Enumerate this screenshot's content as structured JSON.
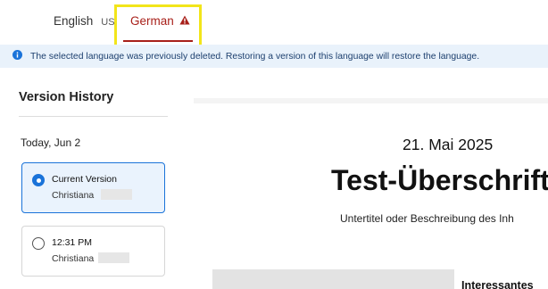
{
  "tabs": {
    "english": {
      "label": "English",
      "region": "US"
    },
    "german": {
      "label": "German"
    }
  },
  "banner": {
    "message": "The selected language was previously deleted. Restoring a version of this language will restore the language."
  },
  "sidebar": {
    "title": "Version History",
    "date_header": "Today, Jun 2",
    "versions": [
      {
        "title": "Current Version",
        "author": "Christiana",
        "selected": true
      },
      {
        "title": "12:31 PM",
        "author": "Christiana",
        "selected": false
      }
    ]
  },
  "preview": {
    "date": "21. Mai 2025",
    "heading": "Test-Überschrift",
    "subtitle": "Untertitel oder Beschreibung des Inh",
    "side_heading": "Interessantes"
  },
  "colors": {
    "accent": "#1a73d9",
    "warning": "#a8201a",
    "banner_bg": "#e9f2fb",
    "highlight": "#f2e51a"
  }
}
